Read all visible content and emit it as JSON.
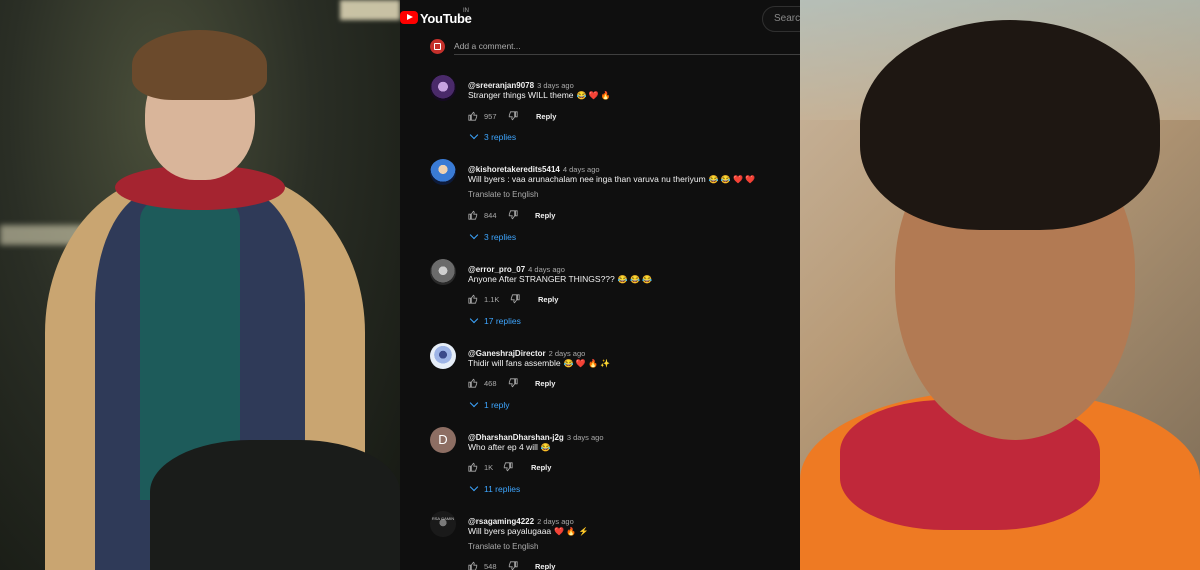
{
  "header": {
    "logo_text": "YouTube",
    "region": "IN",
    "search_placeholder": "Search"
  },
  "add_comment": {
    "placeholder": "Add a comment..."
  },
  "comments": [
    {
      "handle": "@sreeranjan9078",
      "time": "3 days ago",
      "text": "Stranger things WILL theme",
      "emojis": "😂 ❤️ 🔥",
      "likes": "957",
      "reply_label": "Reply",
      "replies": "3 replies",
      "translate": ""
    },
    {
      "handle": "@kishoretakeredits5414",
      "time": "4 days ago",
      "text": "Will byers : vaa arunachalam nee inga than varuva nu theriyum",
      "emojis": "😂 😂 ❤️ ❤️",
      "likes": "844",
      "reply_label": "Reply",
      "replies": "3 replies",
      "translate": "Translate to English"
    },
    {
      "handle": "@error_pro_07",
      "time": "4 days ago",
      "text": "Anyone After STRANGER THINGS???",
      "emojis": "😂 😂 😂",
      "likes": "1.1K",
      "reply_label": "Reply",
      "replies": "17 replies",
      "translate": ""
    },
    {
      "handle": "@GaneshrajDirector",
      "time": "2 days ago",
      "text": "Thidir will fans assemble",
      "emojis": "😂 ❤️ 🔥 ✨",
      "likes": "468",
      "reply_label": "Reply",
      "replies": "1 reply",
      "translate": ""
    },
    {
      "handle": "@DharshanDharshan-j2g",
      "time": "3 days ago",
      "text": "Who after ep 4 will",
      "emojis": "😂",
      "likes": "1K",
      "reply_label": "Reply",
      "replies": "11 replies",
      "translate": "",
      "avatar_letter": "D"
    },
    {
      "handle": "@rsagaming4222",
      "time": "2 days ago",
      "text": "Will byers payalugaaa",
      "emojis": "❤️ 🔥 ⚡",
      "likes": "548",
      "reply_label": "Reply",
      "replies": "",
      "translate": "Translate to English",
      "avatar_text": "RSA GAMIN"
    }
  ],
  "colors": {
    "background": "#0f0f0f",
    "link": "#3ea6ff",
    "brand_red": "#ff0000",
    "muted_text": "#aaaaaa"
  },
  "icons": [
    "youtube-logo-icon",
    "thumb-up-icon",
    "thumb-down-icon",
    "chevron-down-icon"
  ]
}
